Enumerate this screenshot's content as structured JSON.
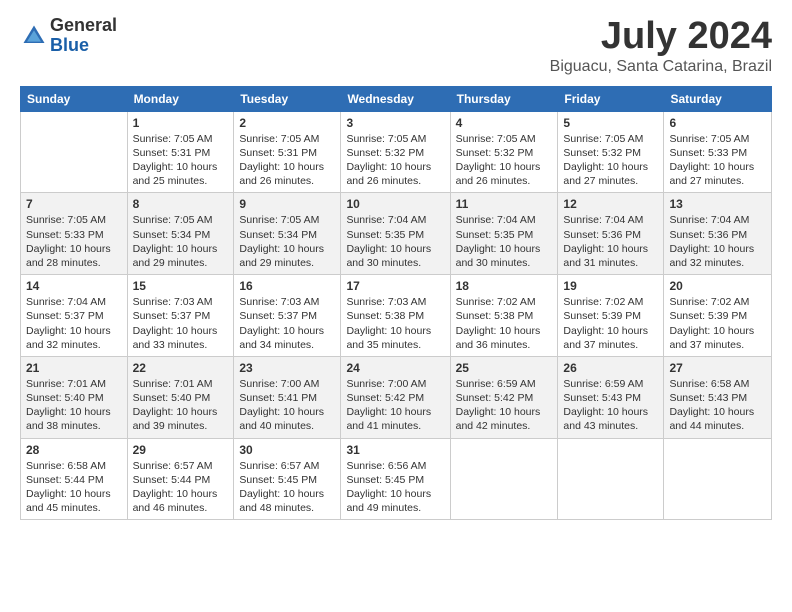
{
  "logo": {
    "general": "General",
    "blue": "Blue"
  },
  "title": "July 2024",
  "location": "Biguacu, Santa Catarina, Brazil",
  "days_of_week": [
    "Sunday",
    "Monday",
    "Tuesday",
    "Wednesday",
    "Thursday",
    "Friday",
    "Saturday"
  ],
  "weeks": [
    [
      {
        "day": "",
        "sunrise": "",
        "sunset": "",
        "daylight": ""
      },
      {
        "day": "1",
        "sunrise": "Sunrise: 7:05 AM",
        "sunset": "Sunset: 5:31 PM",
        "daylight": "Daylight: 10 hours and 25 minutes."
      },
      {
        "day": "2",
        "sunrise": "Sunrise: 7:05 AM",
        "sunset": "Sunset: 5:31 PM",
        "daylight": "Daylight: 10 hours and 26 minutes."
      },
      {
        "day": "3",
        "sunrise": "Sunrise: 7:05 AM",
        "sunset": "Sunset: 5:32 PM",
        "daylight": "Daylight: 10 hours and 26 minutes."
      },
      {
        "day": "4",
        "sunrise": "Sunrise: 7:05 AM",
        "sunset": "Sunset: 5:32 PM",
        "daylight": "Daylight: 10 hours and 26 minutes."
      },
      {
        "day": "5",
        "sunrise": "Sunrise: 7:05 AM",
        "sunset": "Sunset: 5:32 PM",
        "daylight": "Daylight: 10 hours and 27 minutes."
      },
      {
        "day": "6",
        "sunrise": "Sunrise: 7:05 AM",
        "sunset": "Sunset: 5:33 PM",
        "daylight": "Daylight: 10 hours and 27 minutes."
      }
    ],
    [
      {
        "day": "7",
        "sunrise": "Sunrise: 7:05 AM",
        "sunset": "Sunset: 5:33 PM",
        "daylight": "Daylight: 10 hours and 28 minutes."
      },
      {
        "day": "8",
        "sunrise": "Sunrise: 7:05 AM",
        "sunset": "Sunset: 5:34 PM",
        "daylight": "Daylight: 10 hours and 29 minutes."
      },
      {
        "day": "9",
        "sunrise": "Sunrise: 7:05 AM",
        "sunset": "Sunset: 5:34 PM",
        "daylight": "Daylight: 10 hours and 29 minutes."
      },
      {
        "day": "10",
        "sunrise": "Sunrise: 7:04 AM",
        "sunset": "Sunset: 5:35 PM",
        "daylight": "Daylight: 10 hours and 30 minutes."
      },
      {
        "day": "11",
        "sunrise": "Sunrise: 7:04 AM",
        "sunset": "Sunset: 5:35 PM",
        "daylight": "Daylight: 10 hours and 30 minutes."
      },
      {
        "day": "12",
        "sunrise": "Sunrise: 7:04 AM",
        "sunset": "Sunset: 5:36 PM",
        "daylight": "Daylight: 10 hours and 31 minutes."
      },
      {
        "day": "13",
        "sunrise": "Sunrise: 7:04 AM",
        "sunset": "Sunset: 5:36 PM",
        "daylight": "Daylight: 10 hours and 32 minutes."
      }
    ],
    [
      {
        "day": "14",
        "sunrise": "Sunrise: 7:04 AM",
        "sunset": "Sunset: 5:37 PM",
        "daylight": "Daylight: 10 hours and 32 minutes."
      },
      {
        "day": "15",
        "sunrise": "Sunrise: 7:03 AM",
        "sunset": "Sunset: 5:37 PM",
        "daylight": "Daylight: 10 hours and 33 minutes."
      },
      {
        "day": "16",
        "sunrise": "Sunrise: 7:03 AM",
        "sunset": "Sunset: 5:37 PM",
        "daylight": "Daylight: 10 hours and 34 minutes."
      },
      {
        "day": "17",
        "sunrise": "Sunrise: 7:03 AM",
        "sunset": "Sunset: 5:38 PM",
        "daylight": "Daylight: 10 hours and 35 minutes."
      },
      {
        "day": "18",
        "sunrise": "Sunrise: 7:02 AM",
        "sunset": "Sunset: 5:38 PM",
        "daylight": "Daylight: 10 hours and 36 minutes."
      },
      {
        "day": "19",
        "sunrise": "Sunrise: 7:02 AM",
        "sunset": "Sunset: 5:39 PM",
        "daylight": "Daylight: 10 hours and 37 minutes."
      },
      {
        "day": "20",
        "sunrise": "Sunrise: 7:02 AM",
        "sunset": "Sunset: 5:39 PM",
        "daylight": "Daylight: 10 hours and 37 minutes."
      }
    ],
    [
      {
        "day": "21",
        "sunrise": "Sunrise: 7:01 AM",
        "sunset": "Sunset: 5:40 PM",
        "daylight": "Daylight: 10 hours and 38 minutes."
      },
      {
        "day": "22",
        "sunrise": "Sunrise: 7:01 AM",
        "sunset": "Sunset: 5:40 PM",
        "daylight": "Daylight: 10 hours and 39 minutes."
      },
      {
        "day": "23",
        "sunrise": "Sunrise: 7:00 AM",
        "sunset": "Sunset: 5:41 PM",
        "daylight": "Daylight: 10 hours and 40 minutes."
      },
      {
        "day": "24",
        "sunrise": "Sunrise: 7:00 AM",
        "sunset": "Sunset: 5:42 PM",
        "daylight": "Daylight: 10 hours and 41 minutes."
      },
      {
        "day": "25",
        "sunrise": "Sunrise: 6:59 AM",
        "sunset": "Sunset: 5:42 PM",
        "daylight": "Daylight: 10 hours and 42 minutes."
      },
      {
        "day": "26",
        "sunrise": "Sunrise: 6:59 AM",
        "sunset": "Sunset: 5:43 PM",
        "daylight": "Daylight: 10 hours and 43 minutes."
      },
      {
        "day": "27",
        "sunrise": "Sunrise: 6:58 AM",
        "sunset": "Sunset: 5:43 PM",
        "daylight": "Daylight: 10 hours and 44 minutes."
      }
    ],
    [
      {
        "day": "28",
        "sunrise": "Sunrise: 6:58 AM",
        "sunset": "Sunset: 5:44 PM",
        "daylight": "Daylight: 10 hours and 45 minutes."
      },
      {
        "day": "29",
        "sunrise": "Sunrise: 6:57 AM",
        "sunset": "Sunset: 5:44 PM",
        "daylight": "Daylight: 10 hours and 46 minutes."
      },
      {
        "day": "30",
        "sunrise": "Sunrise: 6:57 AM",
        "sunset": "Sunset: 5:45 PM",
        "daylight": "Daylight: 10 hours and 48 minutes."
      },
      {
        "day": "31",
        "sunrise": "Sunrise: 6:56 AM",
        "sunset": "Sunset: 5:45 PM",
        "daylight": "Daylight: 10 hours and 49 minutes."
      },
      {
        "day": "",
        "sunrise": "",
        "sunset": "",
        "daylight": ""
      },
      {
        "day": "",
        "sunrise": "",
        "sunset": "",
        "daylight": ""
      },
      {
        "day": "",
        "sunrise": "",
        "sunset": "",
        "daylight": ""
      }
    ]
  ]
}
